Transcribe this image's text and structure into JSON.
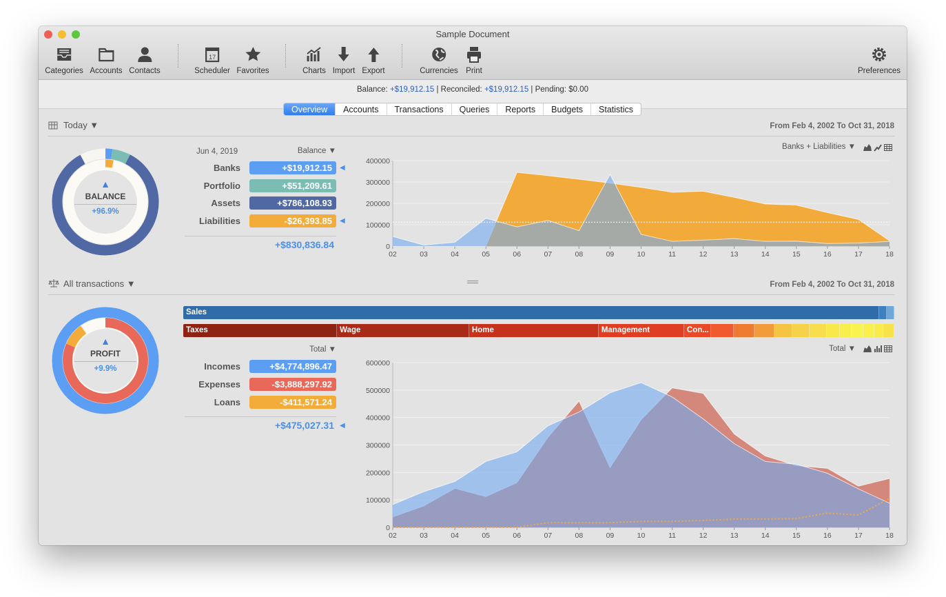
{
  "window": {
    "title": "Sample Document",
    "lights": [
      "#ee5f57",
      "#f5bd2f",
      "#5fc73f"
    ]
  },
  "toolbar": [
    {
      "label": "Categories",
      "icon": "tray-icon"
    },
    {
      "label": "Accounts",
      "icon": "folder-icon"
    },
    {
      "label": "Contacts",
      "icon": "person-icon"
    },
    {
      "label": "Scheduler",
      "icon": "calendar-icon",
      "glyph": "17"
    },
    {
      "label": "Favorites",
      "icon": "star-icon"
    },
    {
      "label": "Charts",
      "icon": "chart-icon"
    },
    {
      "label": "Import",
      "icon": "arrow-down-icon"
    },
    {
      "label": "Export",
      "icon": "arrow-up-icon"
    },
    {
      "label": "Currencies",
      "icon": "globe-icon"
    },
    {
      "label": "Print",
      "icon": "printer-icon"
    },
    {
      "label": "Preferences",
      "icon": "gear-icon"
    }
  ],
  "status": {
    "balance_label": "Balance:",
    "balance": "+$19,912.15",
    "reconciled_label": "| Reconciled:",
    "reconciled": "+$19,912.15",
    "pending": "| Pending: $0.00"
  },
  "tabs": [
    "Overview",
    "Accounts",
    "Transactions",
    "Queries",
    "Reports",
    "Budgets",
    "Statistics"
  ],
  "balance_section": {
    "period": "Today ▼",
    "range": "From Feb 4, 2002 To Oct 31, 2018",
    "donut_title": "BALANCE",
    "donut_pct": "+96.9%",
    "date": "Jun 4, 2019",
    "mode": "Balance ▼",
    "rows": [
      {
        "label": "Banks",
        "value": "+$19,912.15",
        "amount": 19912.15,
        "color": "#5b9ef4",
        "marked": true
      },
      {
        "label": "Portfolio",
        "value": "+$51,209.61",
        "amount": 51209.61,
        "color": "#7bbdb3",
        "marked": false
      },
      {
        "label": "Assets",
        "value": "+$786,108.93",
        "amount": 786108.93,
        "color": "#5069a5",
        "marked": false
      },
      {
        "label": "Liabilities",
        "value": "-$26,393.85",
        "amount": -26393.85,
        "color": "#f3ac3a",
        "marked": true
      }
    ],
    "total": "+$830,836.84",
    "chart_selector": "Banks + Liabilities ▼"
  },
  "transactions_section": {
    "period": "All transactions ▼",
    "range": "From Feb 4, 2002 To Oct 31, 2018",
    "donut_title": "PROFIT",
    "donut_pct": "+9.9%",
    "mode": "Total ▼",
    "rows": [
      {
        "label": "Incomes",
        "value": "+$4,774,896.47",
        "amount": 4774896.47,
        "color": "#5b9ef4"
      },
      {
        "label": "Expenses",
        "value": "-$3,888,297.92",
        "amount": -3888297.92,
        "color": "#e8695a"
      },
      {
        "label": "Loans",
        "value": "-$411,571.24",
        "amount": -411571.24,
        "color": "#f3ac3a"
      }
    ],
    "total": "+$475,027.31",
    "chart_selector": "Total ▼",
    "income_bar": [
      {
        "label": "Sales",
        "share": 98.8,
        "color": "#2f6ca8"
      },
      {
        "label": "",
        "share": 0.6,
        "color": "#3f80c0"
      },
      {
        "label": "",
        "share": 0.6,
        "color": "#6fa7db"
      }
    ],
    "expense_bar": [
      {
        "label": "Taxes",
        "share": 22.9,
        "color": "#8e2313"
      },
      {
        "label": "Wage",
        "share": 19.6,
        "color": "#a92a18"
      },
      {
        "label": "Home",
        "share": 19.2,
        "color": "#c5331c"
      },
      {
        "label": "Management",
        "share": 12.5,
        "color": "#df3e22"
      },
      {
        "label": "Con...",
        "share": 3.6,
        "color": "#e84a27"
      },
      {
        "label": "",
        "share": 2.9,
        "color": "#ef5a2e"
      },
      {
        "label": "",
        "share": 2.6,
        "color": "#ef7b30"
      },
      {
        "label": "",
        "share": 2.6,
        "color": "#f29b3a"
      },
      {
        "label": "",
        "share": 2.2,
        "color": "#f5c443"
      },
      {
        "label": "",
        "share": 2.1,
        "color": "#f6d24a"
      },
      {
        "label": "",
        "share": 2.1,
        "color": "#f8de4c"
      },
      {
        "label": "",
        "share": 1.4,
        "color": "#f8e84c"
      },
      {
        "label": "",
        "share": 1.3,
        "color": "#f8ee4c"
      },
      {
        "label": "",
        "share": 1.2,
        "color": "#f9f34e"
      },
      {
        "label": "",
        "share": 1.2,
        "color": "#f9f04e"
      },
      {
        "label": "",
        "share": 0.8,
        "color": "#f9ea4e"
      },
      {
        "label": "",
        "share": 1.2,
        "color": "#f8e24c"
      }
    ]
  },
  "chart_data": [
    {
      "type": "area",
      "categories": [
        "02",
        "03",
        "04",
        "05",
        "06",
        "07",
        "08",
        "09",
        "10",
        "11",
        "12",
        "13",
        "14",
        "15",
        "16",
        "17",
        "18"
      ],
      "ylim": [
        0,
        400000
      ],
      "yticks": [
        0,
        100000,
        200000,
        300000,
        400000
      ],
      "grid": true,
      "series": [
        {
          "name": "Liabilities",
          "color": "#f2ab3a",
          "values": [
            0,
            0,
            0,
            0,
            345000,
            330000,
            313000,
            295000,
            275000,
            252000,
            257000,
            228000,
            197000,
            192000,
            157000,
            125000,
            25000
          ]
        },
        {
          "name": "Banks",
          "color": "#5b9ef4",
          "values": [
            45000,
            5000,
            18000,
            130000,
            90000,
            120000,
            72000,
            335000,
            55000,
            22000,
            28000,
            35000,
            22000,
            23000,
            12000,
            14000,
            22000
          ]
        }
      ],
      "reference_line": 112000
    },
    {
      "type": "area",
      "categories": [
        "02",
        "03",
        "04",
        "05",
        "06",
        "07",
        "08",
        "09",
        "10",
        "11",
        "12",
        "13",
        "14",
        "15",
        "16",
        "17",
        "18"
      ],
      "ylim": [
        0,
        600000
      ],
      "yticks": [
        0,
        100000,
        200000,
        300000,
        400000,
        500000,
        600000
      ],
      "grid": true,
      "series": [
        {
          "name": "Expenses",
          "color": "#d4887b",
          "values": [
            38000,
            78000,
            142000,
            112000,
            163000,
            328000,
            460000,
            218000,
            392000,
            508000,
            488000,
            340000,
            260000,
            225000,
            215000,
            150000,
            178000
          ]
        },
        {
          "name": "Incomes",
          "color": "#5b9ef4",
          "values": [
            83000,
            130000,
            167000,
            240000,
            275000,
            370000,
            420000,
            490000,
            527000,
            475000,
            395000,
            305000,
            240000,
            230000,
            197000,
            140000,
            88000
          ]
        },
        {
          "name": "Loans",
          "color": "#f3ac3a",
          "style": "dotted",
          "values": [
            0,
            0,
            0,
            0,
            0,
            17000,
            17000,
            17000,
            22000,
            22000,
            25000,
            30000,
            30000,
            32000,
            52000,
            45000,
            105000
          ]
        }
      ]
    }
  ]
}
